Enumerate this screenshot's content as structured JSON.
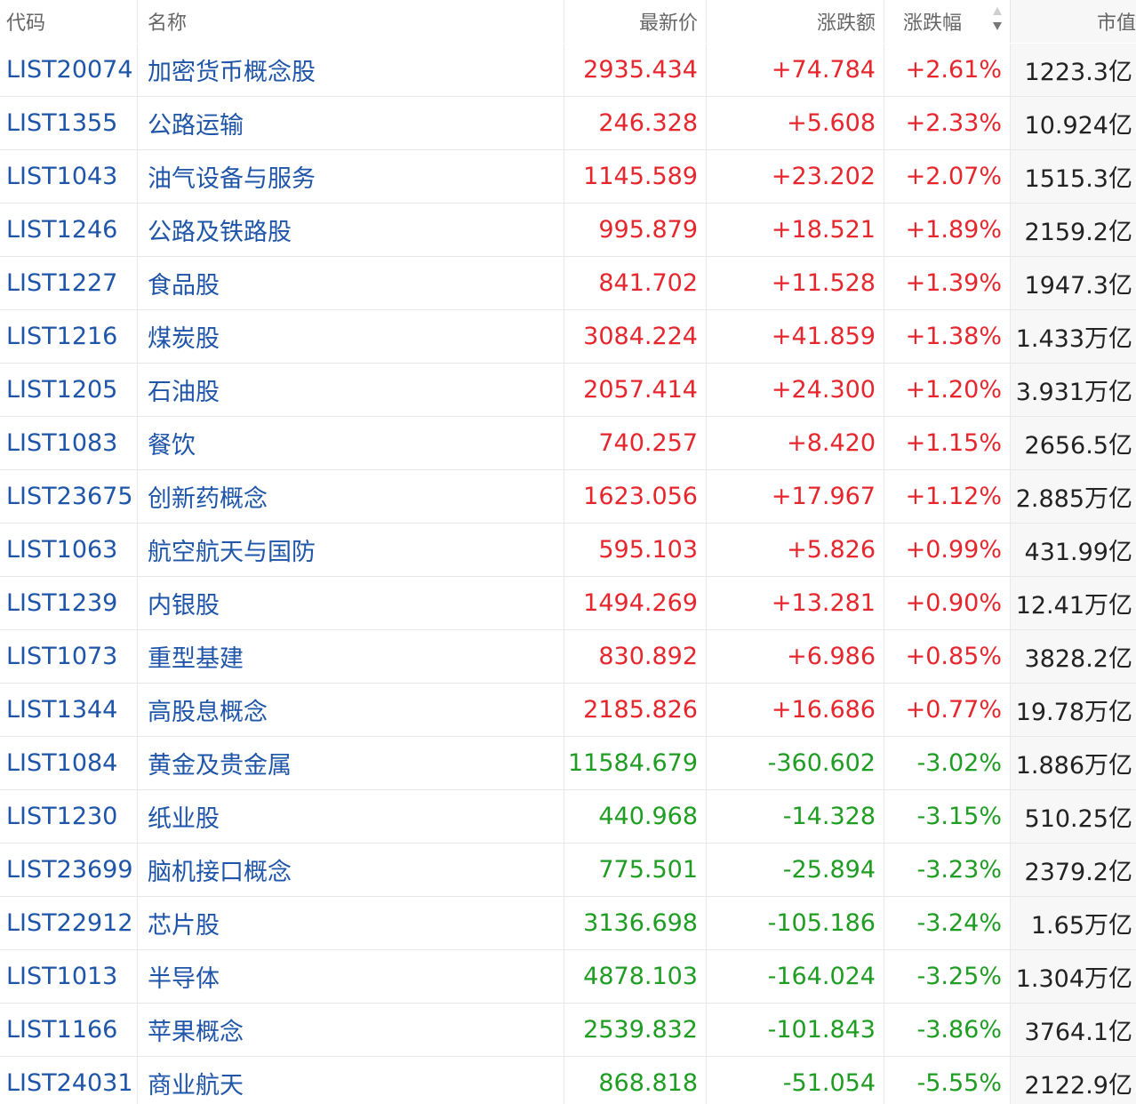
{
  "header": {
    "code": "代码",
    "name": "名称",
    "price": "最新价",
    "change": "涨跌额",
    "pct": "涨跌幅",
    "cap": "市值",
    "sort_icon": "sort-desc-icon"
  },
  "colors": {
    "up": "#e6262d",
    "down": "#1f9d23",
    "link": "#1f55a8"
  },
  "rows": [
    {
      "code": "LIST20074",
      "name": "加密货币概念股",
      "price": "2935.434",
      "change": "+74.784",
      "pct": "+2.61%",
      "cap": "1223.3亿",
      "dir": "up"
    },
    {
      "code": "LIST1355",
      "name": "公路运输",
      "price": "246.328",
      "change": "+5.608",
      "pct": "+2.33%",
      "cap": "10.924亿",
      "dir": "up"
    },
    {
      "code": "LIST1043",
      "name": "油气设备与服务",
      "price": "1145.589",
      "change": "+23.202",
      "pct": "+2.07%",
      "cap": "1515.3亿",
      "dir": "up"
    },
    {
      "code": "LIST1246",
      "name": "公路及铁路股",
      "price": "995.879",
      "change": "+18.521",
      "pct": "+1.89%",
      "cap": "2159.2亿",
      "dir": "up"
    },
    {
      "code": "LIST1227",
      "name": "食品股",
      "price": "841.702",
      "change": "+11.528",
      "pct": "+1.39%",
      "cap": "1947.3亿",
      "dir": "up"
    },
    {
      "code": "LIST1216",
      "name": "煤炭股",
      "price": "3084.224",
      "change": "+41.859",
      "pct": "+1.38%",
      "cap": "1.433万亿",
      "dir": "up"
    },
    {
      "code": "LIST1205",
      "name": "石油股",
      "price": "2057.414",
      "change": "+24.300",
      "pct": "+1.20%",
      "cap": "3.931万亿",
      "dir": "up"
    },
    {
      "code": "LIST1083",
      "name": "餐饮",
      "price": "740.257",
      "change": "+8.420",
      "pct": "+1.15%",
      "cap": "2656.5亿",
      "dir": "up"
    },
    {
      "code": "LIST23675",
      "name": "创新药概念",
      "price": "1623.056",
      "change": "+17.967",
      "pct": "+1.12%",
      "cap": "2.885万亿",
      "dir": "up"
    },
    {
      "code": "LIST1063",
      "name": "航空航天与国防",
      "price": "595.103",
      "change": "+5.826",
      "pct": "+0.99%",
      "cap": "431.99亿",
      "dir": "up"
    },
    {
      "code": "LIST1239",
      "name": "内银股",
      "price": "1494.269",
      "change": "+13.281",
      "pct": "+0.90%",
      "cap": "12.41万亿",
      "dir": "up"
    },
    {
      "code": "LIST1073",
      "name": "重型基建",
      "price": "830.892",
      "change": "+6.986",
      "pct": "+0.85%",
      "cap": "3828.2亿",
      "dir": "up"
    },
    {
      "code": "LIST1344",
      "name": "高股息概念",
      "price": "2185.826",
      "change": "+16.686",
      "pct": "+0.77%",
      "cap": "19.78万亿",
      "dir": "up"
    },
    {
      "code": "LIST1084",
      "name": "黄金及贵金属",
      "price": "11584.679",
      "change": "-360.602",
      "pct": "-3.02%",
      "cap": "1.886万亿",
      "dir": "down"
    },
    {
      "code": "LIST1230",
      "name": "纸业股",
      "price": "440.968",
      "change": "-14.328",
      "pct": "-3.15%",
      "cap": "510.25亿",
      "dir": "down"
    },
    {
      "code": "LIST23699",
      "name": "脑机接口概念",
      "price": "775.501",
      "change": "-25.894",
      "pct": "-3.23%",
      "cap": "2379.2亿",
      "dir": "down"
    },
    {
      "code": "LIST22912",
      "name": "芯片股",
      "price": "3136.698",
      "change": "-105.186",
      "pct": "-3.24%",
      "cap": "1.65万亿",
      "dir": "down"
    },
    {
      "code": "LIST1013",
      "name": "半导体",
      "price": "4878.103",
      "change": "-164.024",
      "pct": "-3.25%",
      "cap": "1.304万亿",
      "dir": "down"
    },
    {
      "code": "LIST1166",
      "name": "苹果概念",
      "price": "2539.832",
      "change": "-101.843",
      "pct": "-3.86%",
      "cap": "3764.1亿",
      "dir": "down"
    },
    {
      "code": "LIST24031",
      "name": "商业航天",
      "price": "868.818",
      "change": "-51.054",
      "pct": "-5.55%",
      "cap": "2122.9亿",
      "dir": "down"
    }
  ]
}
